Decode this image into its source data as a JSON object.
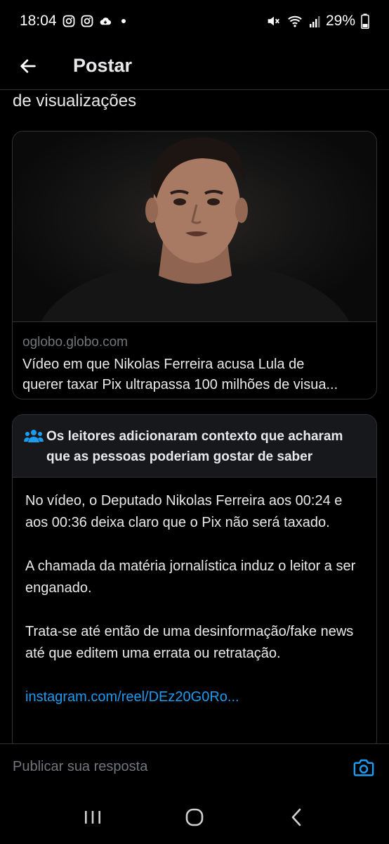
{
  "status_bar": {
    "time": "18:04",
    "battery": "29%",
    "icons": [
      "instagram-icon",
      "instagram-icon",
      "cloud-icon",
      "mute-icon",
      "wifi-icon",
      "signal-icon",
      "battery-icon"
    ]
  },
  "header": {
    "title": "Postar"
  },
  "tweet": {
    "text_tail": "de visualizações"
  },
  "link_card": {
    "domain": "oglobo.globo.com",
    "title_line1": "Vídeo em que Nikolas Ferreira acusa Lula de",
    "title_line2": "querer taxar Pix ultrapassa 100 milhões de visua..."
  },
  "community_note": {
    "header": "Os leitores adicionaram contexto que acharam que as pessoas poderiam gostar de saber",
    "paragraph1": "No vídeo, o Deputado Nikolas Ferreira aos 00:24 e aos 00:36 deixa claro que o Pix não será taxado.",
    "paragraph2": "A chamada da matéria jornalística induz o leitor a ser enganado.",
    "paragraph3": "Trata-se até então de uma desinformação/fake news até que editem uma errata ou retratação.",
    "link": "instagram.com/reel/DEz20G0Ro..."
  },
  "reply": {
    "placeholder": "Publicar sua resposta"
  },
  "colors": {
    "background": "#000000",
    "text": "#e7e9ea",
    "muted": "#71767b",
    "link": "#1d9bf0",
    "border": "#2f3336"
  }
}
